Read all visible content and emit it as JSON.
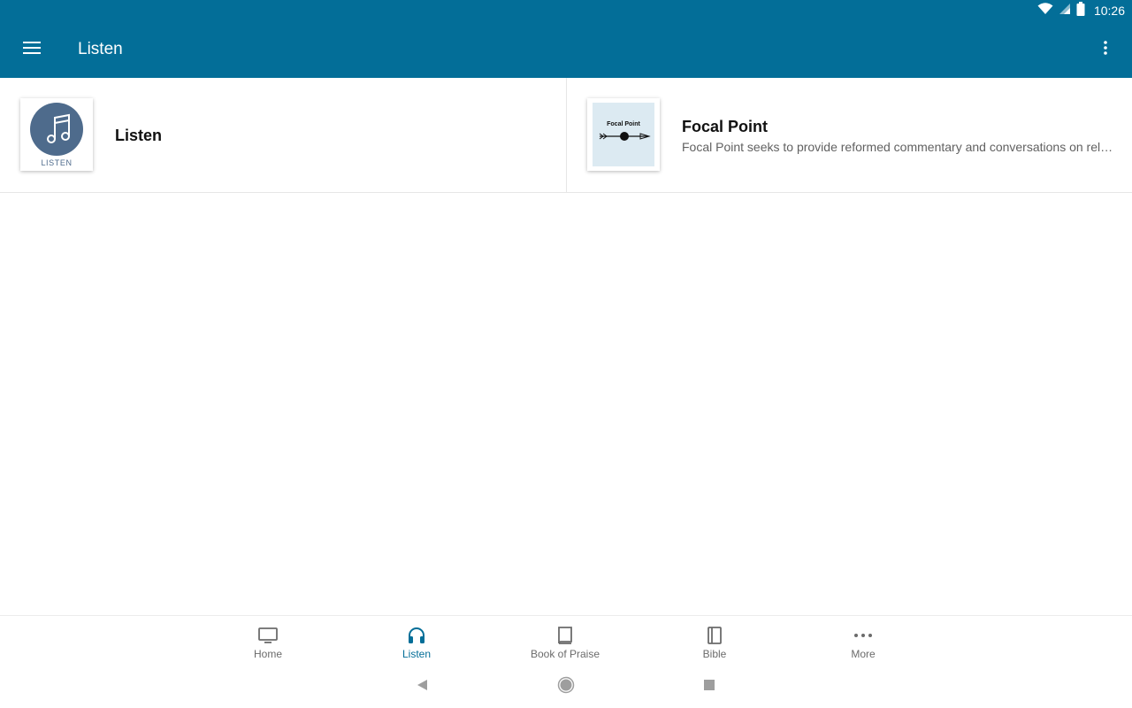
{
  "status_bar": {
    "time": "10:26",
    "icons": [
      "wifi-icon",
      "cell-signal-icon",
      "battery-icon"
    ]
  },
  "app_bar": {
    "title": "Listen",
    "menu_icon": "hamburger-menu-icon",
    "overflow_icon": "more-vertical-icon"
  },
  "items": [
    {
      "title": "Listen",
      "description": "",
      "thumbnail_caption": "LISTEN"
    },
    {
      "title": "Focal Point",
      "description": "Focal Point seeks to provide reformed commentary and conversations on relevant topics.",
      "thumbnail_caption": "Focal Point"
    }
  ],
  "bottom_nav": {
    "active": "Listen",
    "items": [
      {
        "label": "Home",
        "icon": "tv-icon"
      },
      {
        "label": "Listen",
        "icon": "headphones-icon"
      },
      {
        "label": "Book of Praise",
        "icon": "book-icon"
      },
      {
        "label": "Bible",
        "icon": "bible-icon"
      },
      {
        "label": "More",
        "icon": "more-horizontal-icon"
      }
    ]
  },
  "colors": {
    "primary": "#036e98",
    "thumb_circle": "#4e6b8c",
    "focal_bg": "#dceaf2",
    "divider": "#e6e6e6",
    "inactive": "#6b6b6b"
  }
}
